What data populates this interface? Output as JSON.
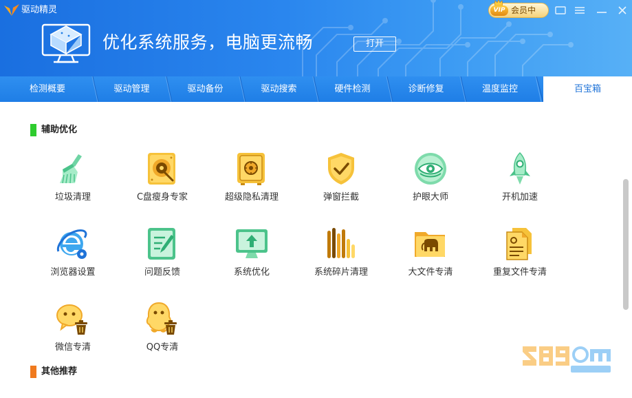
{
  "app": {
    "title": "驱动精灵"
  },
  "vip": {
    "badge": "VIP",
    "label": "会员中"
  },
  "banner": {
    "slogan": "优化系统服务，电脑更流畅",
    "open_button": "打开"
  },
  "tabs": [
    {
      "label": "检测概要"
    },
    {
      "label": "驱动管理"
    },
    {
      "label": "驱动备份"
    },
    {
      "label": "驱动搜索"
    },
    {
      "label": "硬件检测"
    },
    {
      "label": "诊断修复"
    },
    {
      "label": "温度监控"
    },
    {
      "label": "百宝箱",
      "active": true
    }
  ],
  "sections": [
    {
      "title": "辅助优化",
      "color": "#2ecc2e"
    },
    {
      "title": "其他推荐",
      "color": "#f07a1e"
    }
  ],
  "tools": [
    {
      "label": "垃圾清理",
      "icon": "broom-icon"
    },
    {
      "label": "C盘瘦身专家",
      "icon": "disk-icon"
    },
    {
      "label": "超级隐私清理",
      "icon": "safe-icon"
    },
    {
      "label": "弹窗拦截",
      "icon": "shield-icon"
    },
    {
      "label": "护眼大师",
      "icon": "eye-icon"
    },
    {
      "label": "开机加速",
      "icon": "rocket-icon"
    },
    {
      "label": "浏览器设置",
      "icon": "browser-icon"
    },
    {
      "label": "问题反馈",
      "icon": "feedback-icon"
    },
    {
      "label": "系统优化",
      "icon": "monitor-upload-icon"
    },
    {
      "label": "系统碎片清理",
      "icon": "fragment-icon"
    },
    {
      "label": "大文件专清",
      "icon": "folder-icon"
    },
    {
      "label": "重复文件专清",
      "icon": "document-icon"
    },
    {
      "label": "微信专清",
      "icon": "wechat-trash-icon"
    },
    {
      "label": "QQ专清",
      "icon": "qq-trash-icon"
    }
  ],
  "colors": {
    "header": "#1f7ee6",
    "accent": "#1f73d8",
    "gold": "#f2b21c"
  }
}
